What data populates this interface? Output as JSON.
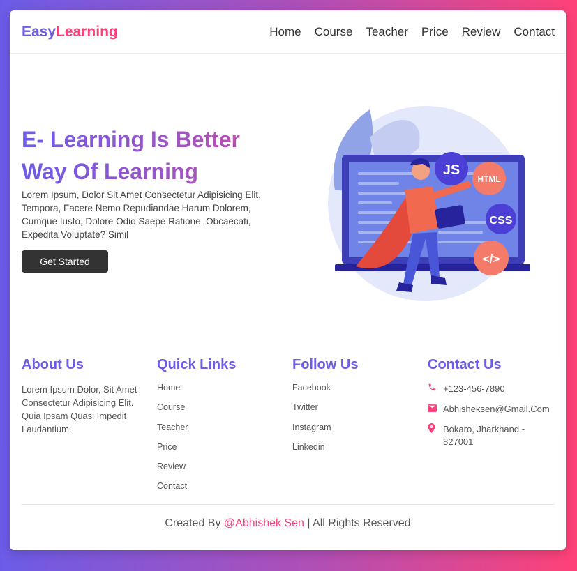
{
  "brand": {
    "part1": "Easy",
    "part2": "Learning"
  },
  "nav": [
    "Home",
    "Course",
    "Teacher",
    "Price",
    "Review",
    "Contact"
  ],
  "hero": {
    "title": "E- Learning Is Better Way Of Learning",
    "text": "Lorem Ipsum, Dolor Sit Amet Consectetur Adipisicing Elit. Tempora, Facere Nemo Repudiandae Harum Dolorem, Cumque Iusto, Dolore Odio Saepe Ratione. Obcaecati, Expedita Voluptate? Simil",
    "button": "Get Started",
    "badges": {
      "js": "JS",
      "html": "HTML",
      "css": "CSS",
      "code": "</>"
    }
  },
  "about": {
    "heading": "About Us",
    "text": "Lorem Ipsum Dolor, Sit Amet Consectetur Adipisicing Elit. Quia Ipsam Quasi Impedit Laudantium."
  },
  "quick_links": {
    "heading": "Quick Links",
    "items": [
      "Home",
      "Course",
      "Teacher",
      "Price",
      "Review",
      "Contact"
    ]
  },
  "follow": {
    "heading": "Follow Us",
    "items": [
      "Facebook",
      "Twitter",
      "Instagram",
      "Linkedin"
    ]
  },
  "contact": {
    "heading": "Contact Us",
    "phone": "+123-456-7890",
    "email": "Abhisheksen@Gmail.Com",
    "address": "Bokaro, Jharkhand - 827001"
  },
  "footer": {
    "prefix": "Created By",
    "author": "@Abhishek Sen",
    "suffix": "| All Rights Reserved"
  },
  "colors": {
    "primary": "#6c5ce7",
    "accent": "#ff3f7a",
    "button": "#333333"
  }
}
